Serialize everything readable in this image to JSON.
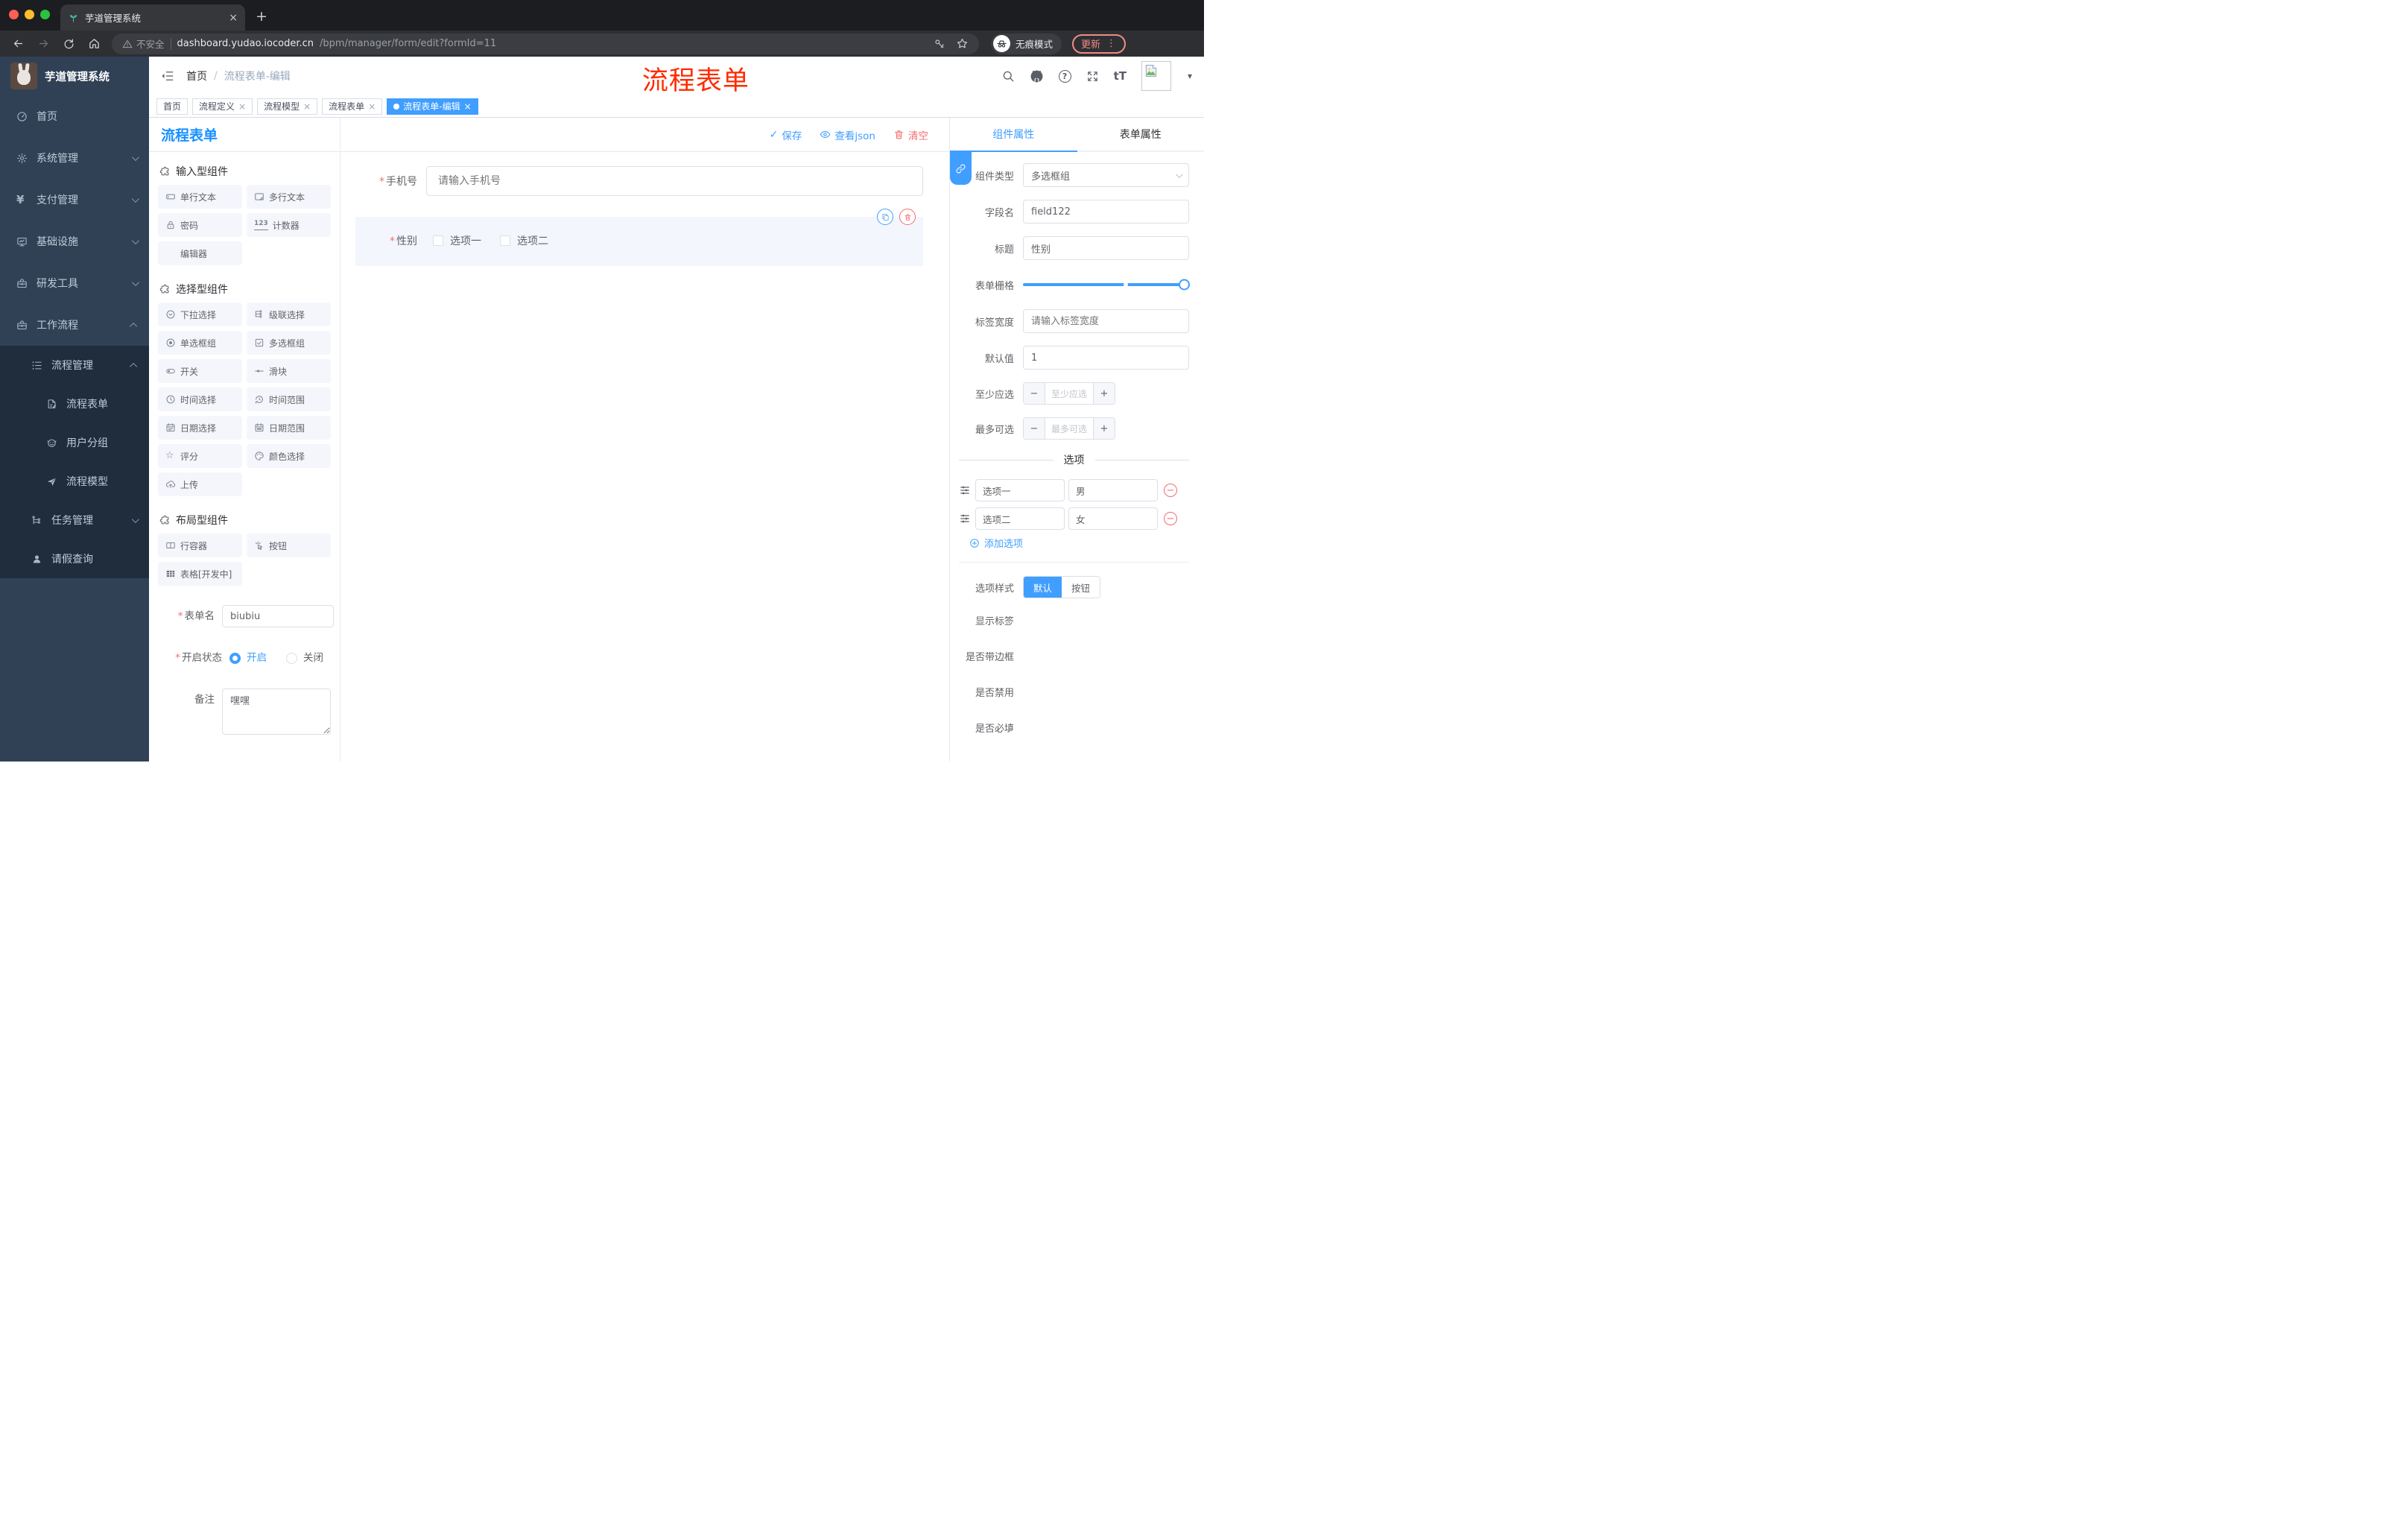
{
  "colors": {
    "primary": "#409EFF",
    "danger": "#F56C6C",
    "annotation_red": "#FF2B00",
    "sidebar_bg": "#304156",
    "sidebar_submenu_bg": "#1F2D3D",
    "update_accent": "#F28B82",
    "panel_title_blue": "#1890FF"
  },
  "icons": {
    "close": "×",
    "new_tab": "+",
    "kebab": "⋮",
    "caret_down": "▾",
    "slash": "/",
    "asterisk": "*",
    "minus": "−",
    "plus": "+",
    "check": "✓",
    "question": "?",
    "yen": "¥",
    "counter": "123",
    "font_size": "tT",
    "star": "☆"
  },
  "browser": {
    "tab_title": "芋道管理系统",
    "security_label": "不安全",
    "url_host": "dashboard.yudao.iocoder.cn",
    "url_path": "/bpm/manager/form/edit?formId=11",
    "incognito_label": "无痕模式",
    "update_label": "更新"
  },
  "sidebar": {
    "app_title": "芋道管理系统",
    "items": [
      {
        "label": "首页"
      },
      {
        "label": "系统管理"
      },
      {
        "label": "支付管理"
      },
      {
        "label": "基础设施"
      },
      {
        "label": "研发工具"
      },
      {
        "label": "工作流程"
      },
      {
        "label": "流程管理"
      },
      {
        "label": "流程表单"
      },
      {
        "label": "用户分组"
      },
      {
        "label": "流程模型"
      },
      {
        "label": "任务管理"
      },
      {
        "label": "请假查询"
      }
    ]
  },
  "header": {
    "breadcrumb_home": "首页",
    "breadcrumb_current": "流程表单-编辑",
    "annotation": "流程表单"
  },
  "tags": [
    {
      "label": "首页"
    },
    {
      "label": "流程定义"
    },
    {
      "label": "流程模型"
    },
    {
      "label": "流程表单"
    },
    {
      "label": "流程表单-编辑"
    }
  ],
  "left_panel": {
    "title": "流程表单",
    "sections": [
      {
        "title": "输入型组件",
        "items": [
          {
            "label": "单行文本"
          },
          {
            "label": "多行文本"
          },
          {
            "label": "密码"
          },
          {
            "label": "计数器"
          },
          {
            "label": "编辑器"
          }
        ]
      },
      {
        "title": "选择型组件",
        "items": [
          {
            "label": "下拉选择"
          },
          {
            "label": "级联选择"
          },
          {
            "label": "单选框组"
          },
          {
            "label": "多选框组"
          },
          {
            "label": "开关"
          },
          {
            "label": "滑块"
          },
          {
            "label": "时间选择"
          },
          {
            "label": "时间范围"
          },
          {
            "label": "日期选择"
          },
          {
            "label": "日期范围"
          },
          {
            "label": "评分"
          },
          {
            "label": "颜色选择"
          },
          {
            "label": "上传"
          }
        ]
      },
      {
        "title": "布局型组件",
        "items": [
          {
            "label": "行容器"
          },
          {
            "label": "按钮"
          },
          {
            "label": "表格[开发中]"
          }
        ]
      }
    ],
    "form": {
      "name_label": "表单名",
      "name_value": "biubiu",
      "status_label": "开启状态",
      "status_on": "开启",
      "status_off": "关闭",
      "remark_label": "备注",
      "remark_value": "嘿嘿"
    }
  },
  "canvas": {
    "actions": {
      "save": "保存",
      "view_json": "查看json",
      "clear": "清空"
    },
    "phone_field": {
      "label": "手机号",
      "placeholder": "请输入手机号"
    },
    "gender_field": {
      "label": "性别",
      "option1": "选项一",
      "option2": "选项二"
    }
  },
  "right_panel": {
    "tabs": {
      "component": "组件属性",
      "form": "表单属性"
    },
    "fields": {
      "component_type_label": "组件类型",
      "component_type_value": "多选框组",
      "field_name_label": "字段名",
      "field_name_value": "field122",
      "title_label": "标题",
      "title_value": "性别",
      "grid_label": "表单栅格",
      "label_width_label": "标签宽度",
      "label_width_placeholder": "请输入标签宽度",
      "default_label": "默认值",
      "default_value": "1",
      "min_label": "至少应选",
      "min_placeholder": "至少应选",
      "max_label": "最多可选",
      "max_placeholder": "最多可选"
    },
    "options": {
      "divider_title": "选项",
      "rows": [
        {
          "label": "选项一",
          "value": "男"
        },
        {
          "label": "选项二",
          "value": "女"
        }
      ],
      "add_label": "添加选项"
    },
    "option_style": {
      "label": "选项样式",
      "default": "默认",
      "button": "按钮"
    },
    "switches": {
      "show_label": "显示标签",
      "bordered": "是否带边框",
      "disabled": "是否禁用",
      "required": "是否必填"
    }
  }
}
